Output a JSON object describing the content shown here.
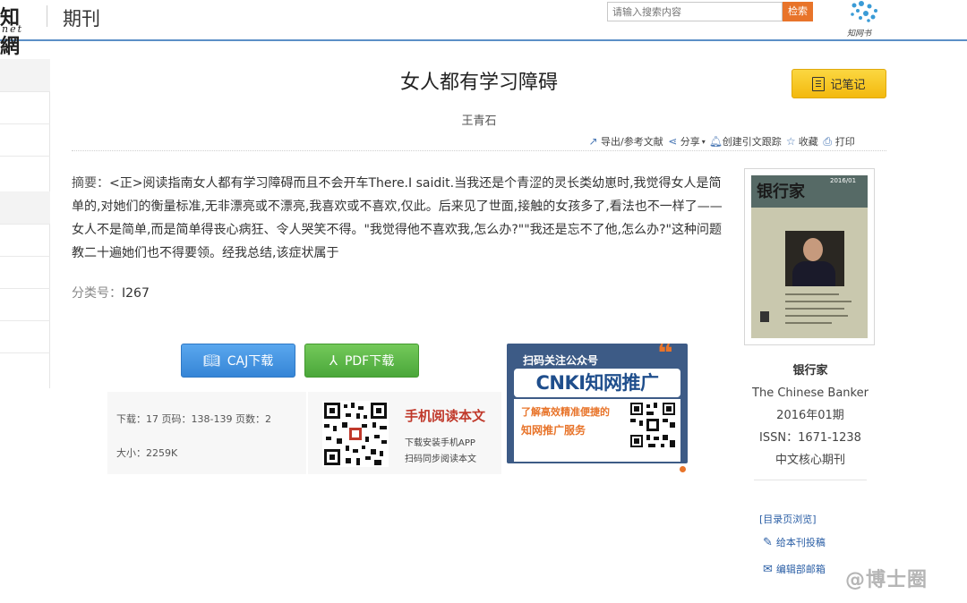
{
  "header": {
    "logo_main": "知網",
    "logo_sub": "net",
    "section": "期刊",
    "search_placeholder": "请输入搜索内容",
    "search_button": "检索",
    "brand_label": "知网书"
  },
  "article": {
    "title": "女人都有学习障碍",
    "author": "王青石",
    "note_button": "记笔记",
    "abstract_label": "摘要：",
    "abstract_text": "<正>阅读指南女人都有学习障碍而且不会开车There.I saidit.当我还是个青涩的灵长类幼崽时,我觉得女人是简单的,对她们的衡量标准,无非漂亮或不漂亮,我喜欢或不喜欢,仅此。后来见了世面,接触的女孩多了,看法也不一样了——女人不是简单,而是简单得丧心病狂、令人哭笑不得。\"我觉得他不喜欢我,怎么办?\"\"我还是忘不了他,怎么办?\"这种问题教二十遍她们也不得要领。经我总结,该症状属于",
    "clc_label": "分类号：",
    "clc_value": "I267"
  },
  "toolbar": {
    "export": "导出/参考文献",
    "share": "分享",
    "track": "创建引文跟踪",
    "favorite": "收藏",
    "print": "打印"
  },
  "downloads": {
    "caj": "CAJ下载",
    "pdf": "PDF下载"
  },
  "stats": {
    "line1": "下载：17   页码：138-139   页数：2",
    "line2": "大小：2259K"
  },
  "mobile": {
    "title": "手机阅读本文",
    "sub1": "下载安装手机APP",
    "sub2": "扫码同步阅读本文"
  },
  "promo": {
    "top": "扫码关注公众号",
    "main": "CNKI知网推广",
    "line1": "了解高效精准便捷的",
    "line2": "知网推广服务"
  },
  "journal": {
    "cover_masthead": "银行家",
    "cover_issue": "2016/01",
    "name": "银行家",
    "english": "The Chinese Banker",
    "issue": "2016年01期",
    "issn": "ISSN：1671-1238",
    "category": "中文核心期刊"
  },
  "side_links": {
    "toc": "[目录页浏览]",
    "submit": "给本刊投稿",
    "editorial": "编辑部邮箱"
  },
  "watermark": "@博士圈",
  "colors": {
    "accent_blue": "#3585d6",
    "accent_green": "#4aa73a",
    "accent_orange": "#e8742a",
    "note_yellow": "#f3b90e"
  }
}
